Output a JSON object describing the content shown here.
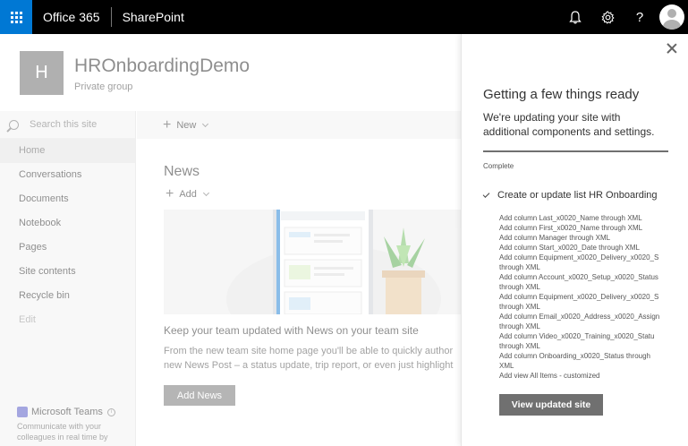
{
  "suite": {
    "app_launcher": "app-launcher-icon",
    "brand": "Office 365",
    "app": "SharePoint",
    "icons": [
      "bell-icon",
      "gear-icon",
      "help-icon"
    ],
    "help_glyph": "?"
  },
  "site": {
    "logo_letter": "H",
    "title": "HROnboardingDemo",
    "subtitle": "Private group"
  },
  "leftnav": {
    "search_placeholder": "Search this site",
    "items": [
      {
        "label": "Home"
      },
      {
        "label": "Conversations"
      },
      {
        "label": "Documents"
      },
      {
        "label": "Notebook"
      },
      {
        "label": "Pages"
      },
      {
        "label": "Site contents"
      },
      {
        "label": "Recycle bin"
      },
      {
        "label": "Edit"
      }
    ],
    "teams": {
      "label": "Microsoft Teams",
      "desc_line1": "Communicate with your",
      "desc_line2": "colleagues in real time by"
    }
  },
  "commandbar": {
    "new_label": "New"
  },
  "news": {
    "title": "News",
    "add_label": "Add",
    "headline": "Keep your team updated with News on your team site",
    "body_line1": "From the new team site home page you'll be able to quickly author",
    "body_line2": "new News Post – a status update, trip report, or even just highlight",
    "add_news_label": "Add News"
  },
  "panel": {
    "title": "Getting a few things ready",
    "description": "We're updating your site with additional components and settings.",
    "status": "Complete",
    "progress": 1.0,
    "task": "Create or update list HR Onboarding",
    "steps": [
      "Add column Last_x0020_Name through XML",
      "Add column First_x0020_Name through XML",
      "Add column Manager through XML",
      "Add column Start_x0020_Date through XML",
      "Add column Equipment_x0020_Delivery_x0020_S",
      "through XML",
      "Add column Account_x0020_Setup_x0020_Status",
      "through XML",
      "Add column Equipment_x0020_Delivery_x0020_S",
      "through XML",
      "Add column Email_x0020_Address_x0020_Assign",
      "through XML",
      "Add column Video_x0020_Training_x0020_Statu",
      "through XML",
      "Add column Onboarding_x0020_Status through",
      "XML",
      "Add view All Items - customized"
    ],
    "button_label": "View updated site"
  }
}
